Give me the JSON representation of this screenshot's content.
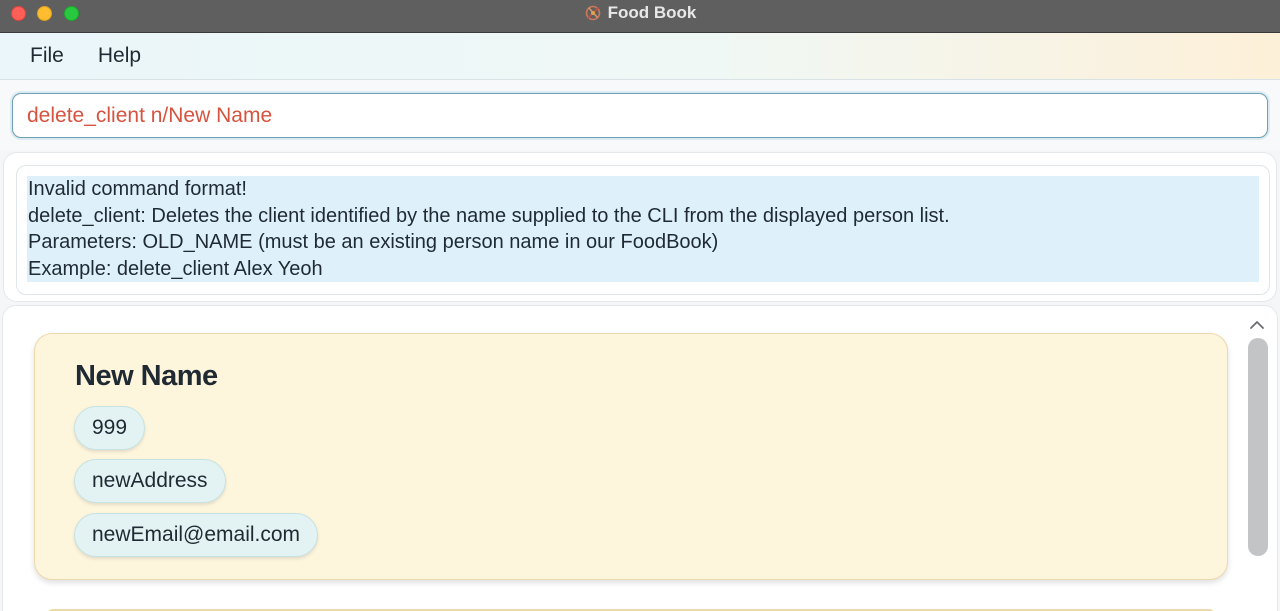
{
  "window": {
    "title": "Food Book",
    "app_icon": "food-book-app-icon"
  },
  "menu": {
    "items": [
      {
        "label": "File"
      },
      {
        "label": "Help"
      }
    ]
  },
  "command": {
    "value": "delete_client n/New Name"
  },
  "result": {
    "lines": [
      "Invalid command format!",
      "delete_client: Deletes the client identified by the name supplied to the CLI from the displayed person list.",
      "Parameters: OLD_NAME (must be an existing person name in our FoodBook)",
      "Example: delete_client Alex Yeoh"
    ]
  },
  "persons": [
    {
      "name": "New Name",
      "phone": "999",
      "address": "newAddress",
      "email": "newEmail@email.com"
    }
  ],
  "colors": {
    "command_text": "#d6533f",
    "result_highlight": "#def0fa",
    "card_background": "#fdf5dc",
    "chip_background": "#e3f3f3"
  }
}
